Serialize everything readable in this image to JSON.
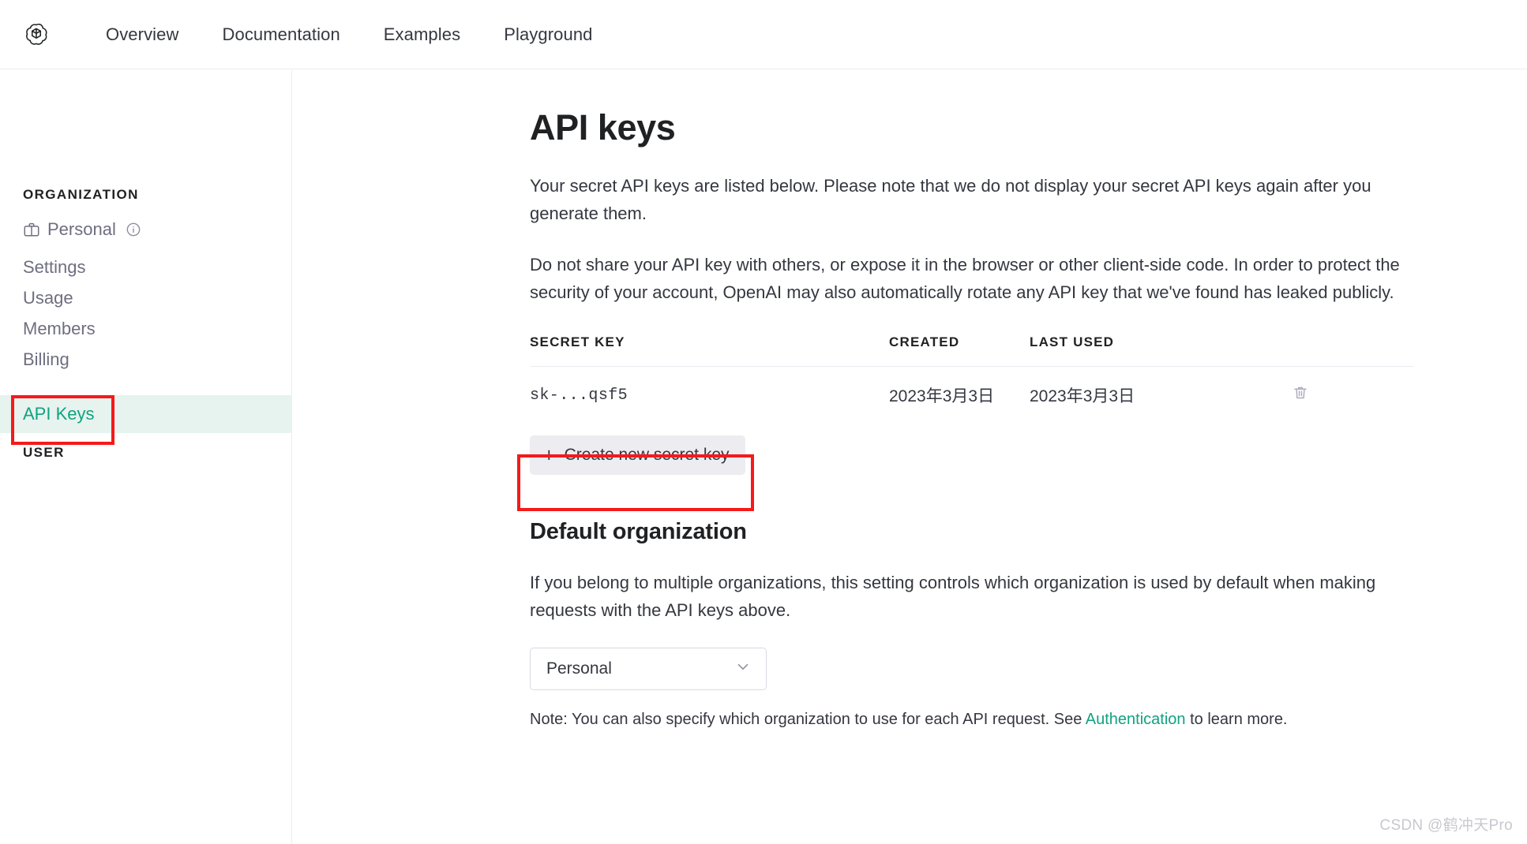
{
  "header": {
    "logo_name": "openai-logo",
    "nav": [
      {
        "label": "Overview"
      },
      {
        "label": "Documentation"
      },
      {
        "label": "Examples"
      },
      {
        "label": "Playground"
      }
    ]
  },
  "sidebar": {
    "organization_label": "ORGANIZATION",
    "user_label": "USER",
    "org_items": [
      {
        "label": "Personal",
        "icon": "briefcase-icon",
        "trailing_icon": "info-circle-icon"
      },
      {
        "label": "Settings"
      },
      {
        "label": "Usage"
      },
      {
        "label": "Members"
      },
      {
        "label": "Billing"
      }
    ],
    "user_items": [
      {
        "label": "API Keys",
        "active": true
      }
    ],
    "active_color": "#10a37f",
    "active_bg": "#e6f3ef"
  },
  "main": {
    "title": "API keys",
    "paragraph_1": "Your secret API keys are listed below. Please note that we do not display your secret API keys again after you generate them.",
    "paragraph_2": "Do not share your API key with others, or expose it in the browser or other client-side code. In order to protect the security of your account, OpenAI may also automatically rotate any API key that we've found has leaked publicly.",
    "table": {
      "columns": [
        "SECRET KEY",
        "CREATED",
        "LAST USED",
        ""
      ],
      "rows": [
        {
          "secret_key": "sk-...qsf5",
          "created": "2023年3月3日",
          "last_used": "2023年3月3日",
          "action_icon": "trash-icon"
        }
      ]
    },
    "create_button": {
      "label": "Create new secret key",
      "icon": "plus-icon"
    },
    "default_org": {
      "title": "Default organization",
      "description": "If you belong to multiple organizations, this setting controls which organization is used by default when making requests with the API keys above.",
      "select_value": "Personal",
      "select_icon": "chevron-down-icon",
      "note_prefix": "Note: You can also specify which organization to use for each API request. See ",
      "note_link": "Authentication",
      "note_suffix": " to learn more."
    }
  },
  "annotations": {
    "color": "#f51a1a",
    "boxes": [
      {
        "name": "api-keys-highlight"
      },
      {
        "name": "create-key-highlight"
      }
    ]
  },
  "watermark": "CSDN @鹤冲天Pro"
}
